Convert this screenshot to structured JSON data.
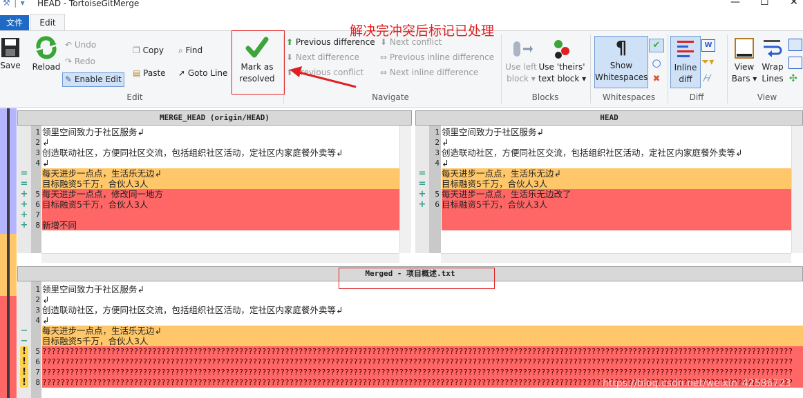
{
  "window": {
    "title": "HEAD - TortoiseGitMerge",
    "min": "—",
    "max": "☐",
    "close": "✕",
    "qa": "⚒ │ ▾"
  },
  "tabs": {
    "file": "文件",
    "edit": "Edit"
  },
  "ribbon": {
    "save": "Save",
    "reload": "Reload",
    "undo": "Undo",
    "redo": "Redo",
    "enable_edit": "Enable Edit",
    "copy": "Copy",
    "paste": "Paste",
    "find": "Find",
    "goto_line": "Goto Line",
    "mark_resolved_1": "Mark as",
    "mark_resolved_2": "resolved",
    "edit_group": "Edit",
    "prev_diff": "Previous difference",
    "next_diff": "Next difference",
    "prev_conflict": "Previous conflict",
    "next_conflict": "Next conflict",
    "prev_inline": "Previous inline difference",
    "next_inline": "Next inline difference",
    "navigate_group": "Navigate",
    "use_left_1": "Use left",
    "use_left_2": "block ▾",
    "use_theirs_1": "Use 'theirs'",
    "use_theirs_2": "text block ▾",
    "blocks_group": "Blocks",
    "show_ws_1": "Show",
    "show_ws_2": "Whitespaces",
    "whitespaces_group": "Whitespaces",
    "inline_diff_1": "Inline",
    "inline_diff_2": "diff",
    "diff_group": "Diff",
    "view_bars_1": "View",
    "view_bars_2": "Bars ▾",
    "wrap_lines_1": "Wrap",
    "wrap_lines_2": "Lines",
    "view_group": "View"
  },
  "annotation": {
    "text": "解决完冲突后标记已处理"
  },
  "left_pane": {
    "header": "MERGE_HEAD (origin/HEAD)",
    "lines": [
      {
        "n": "1",
        "mark": "",
        "text": "领里空间致力于社区服务↲",
        "bg": ""
      },
      {
        "n": "2",
        "mark": "",
        "text": "↲",
        "bg": ""
      },
      {
        "n": "3",
        "mark": "",
        "text": "创造联动社区，方便同社区交流，包括组织社区活动，定社区内家庭餐外卖等↲",
        "bg": ""
      },
      {
        "n": "4",
        "mark": "",
        "text": "↲",
        "bg": ""
      },
      {
        "n": "",
        "mark": "=",
        "text": "每天进步一点点，生活乐无边↲",
        "bg": "yellow"
      },
      {
        "n": "",
        "mark": "=",
        "text": "目标融资5千万，合伙人3人",
        "bg": "yellow"
      },
      {
        "n": "5",
        "mark": "+",
        "text": "每天进步一点点，修改同一地方",
        "bg": "red"
      },
      {
        "n": "6",
        "mark": "+",
        "text": "目标融资5千万，合伙人3人",
        "bg": "red"
      },
      {
        "n": "7",
        "mark": "+",
        "text": "",
        "bg": "red"
      },
      {
        "n": "8",
        "mark": "+",
        "text": "新增不同",
        "bg": "red"
      }
    ]
  },
  "right_pane": {
    "header": "HEAD",
    "lines": [
      {
        "n": "1",
        "mark": "",
        "text": "领里空间致力于社区服务↲",
        "bg": ""
      },
      {
        "n": "2",
        "mark": "",
        "text": "↲",
        "bg": ""
      },
      {
        "n": "3",
        "mark": "",
        "text": "创造联动社区，方便同社区交流，包括组织社区活动，定社区内家庭餐外卖等↲",
        "bg": ""
      },
      {
        "n": "4",
        "mark": "",
        "text": "↲",
        "bg": ""
      },
      {
        "n": "",
        "mark": "=",
        "text": "每天进步一点点，生活乐无边↲",
        "bg": "yellow"
      },
      {
        "n": "",
        "mark": "=",
        "text": "目标融资5千万，合伙人3人",
        "bg": "yellow"
      },
      {
        "n": "5",
        "mark": "+",
        "text": "每天进步一点点，生活乐无边改了",
        "bg": "red"
      },
      {
        "n": "6",
        "mark": "+",
        "text": "目标融资5千万，合伙人3人",
        "bg": "red"
      },
      {
        "n": "",
        "mark": "",
        "text": "",
        "bg": "red"
      },
      {
        "n": "",
        "mark": "",
        "text": "",
        "bg": "red"
      }
    ]
  },
  "merged_pane": {
    "header": "Merged - 项目概述.txt",
    "lines": [
      {
        "n": "1",
        "mark": "",
        "text": "领里空间致力于社区服务↲",
        "bg": ""
      },
      {
        "n": "2",
        "mark": "",
        "text": "↲",
        "bg": ""
      },
      {
        "n": "3",
        "mark": "",
        "text": "创造联动社区，方便同社区交流，包括组织社区活动，定社区内家庭餐外卖等↲",
        "bg": ""
      },
      {
        "n": "4",
        "mark": "",
        "text": "↲",
        "bg": ""
      },
      {
        "n": "",
        "mark": "−",
        "text": "每天进步一点点，生活乐无边↲",
        "bg": "yellow"
      },
      {
        "n": "",
        "mark": "−",
        "text": "目标融资5千万，合伙人3人",
        "bg": "yellow"
      },
      {
        "n": "5",
        "mark": "!",
        "text": "????????????????????????????????????????????????????????????????????????????????????????????????????????????????????????????????????????????????????????????????????",
        "bg": "red"
      },
      {
        "n": "6",
        "mark": "!",
        "text": "????????????????????????????????????????????????????????????????????????????????????????????????????????????????????????????????????????????????????????????????????",
        "bg": "red"
      },
      {
        "n": "7",
        "mark": "!",
        "text": "????????????????????????????????????????????????????????????????????????????????????????????????????????????????????????????????????????????????????????????????????",
        "bg": "red"
      },
      {
        "n": "8",
        "mark": "!",
        "text": "????????????????????????????????????????????????????????????????????????????????????????????????????????????????????????????????????????????????????????????????????",
        "bg": "red"
      }
    ]
  },
  "watermark": "https://blog.csdn.net/weixin_42586723",
  "colors": {
    "conflict": "#ff6666",
    "identical": "#ffc769",
    "accent": "#1e6ac4",
    "annotation": "#e02020"
  }
}
